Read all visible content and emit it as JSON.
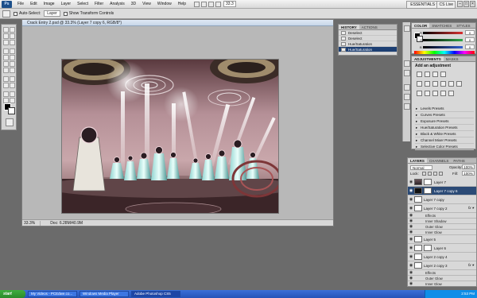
{
  "menubar": {
    "logo": "Ps",
    "items": [
      "File",
      "Edit",
      "Image",
      "Layer",
      "Select",
      "Filter",
      "Analysis",
      "3D",
      "View",
      "Window",
      "Help"
    ],
    "zoom": "33.3",
    "workspace": "ESSENTIALS ▾",
    "cs_label": "CS Live",
    "window_controls": [
      "–",
      "□",
      "×"
    ]
  },
  "options": {
    "auto_select_label": "Auto-Select:",
    "auto_select_value": "Layer",
    "transform_label": "Show Transform Controls"
  },
  "document": {
    "title": "Crack Entry 2.psd @ 33.3% (Layer 7 copy 6, RGB/8*)",
    "zoom": "33.3%",
    "doc_size": "Doc: 6.28M/40.9M"
  },
  "history": {
    "tabs": [
      "HISTORY",
      "ACTIONS"
    ],
    "items": [
      {
        "label": "Deselect"
      },
      {
        "label": "Deselect"
      },
      {
        "label": "Hue/Saturation"
      },
      {
        "label": "Hue/Saturation",
        "selected": true
      }
    ]
  },
  "color_panel": {
    "tabs": [
      "COLOR",
      "SWATCHES",
      "STYLES"
    ],
    "channels": [
      {
        "name": "R",
        "value": "0",
        "color": "#d93030"
      },
      {
        "name": "G",
        "value": "0",
        "color": "#2fa84a"
      },
      {
        "name": "B",
        "value": "0",
        "color": "#2f5fd0"
      }
    ]
  },
  "adjustments": {
    "tabs": [
      "ADJUSTMENTS",
      "MASKS"
    ],
    "heading": "Add an adjustment",
    "presets": [
      "Levels Presets",
      "Curves Presets",
      "Exposure Presets",
      "Hue/Saturation Presets",
      "Black & White Presets",
      "Channel Mixer Presets",
      "Selective Color Presets"
    ]
  },
  "layers": {
    "tabs": [
      "LAYERS",
      "CHANNELS",
      "PATHS"
    ],
    "blend_mode": "Normal",
    "opacity_label": "Opacity:",
    "opacity": "100%",
    "lock_label": "Lock:",
    "fill_label": "Fill:",
    "fill": "100%",
    "rows": [
      {
        "name": "Layer 7",
        "kind": "layer",
        "thumb": "dark",
        "mask": true
      },
      {
        "name": "Layer 7 copy 6",
        "kind": "layer",
        "thumb": "blk",
        "mask": true,
        "selected": true
      },
      {
        "name": "Layer 7 copy",
        "kind": "layer",
        "thumb": "white",
        "mask": false
      },
      {
        "name": "Layer 7 copy 2",
        "kind": "layer",
        "thumb": "white",
        "mask": false,
        "fx": true
      },
      {
        "name": "Effects",
        "kind": "sub"
      },
      {
        "name": "Inner Shadow",
        "kind": "sub"
      },
      {
        "name": "Outer Glow",
        "kind": "sub"
      },
      {
        "name": "Inner Glow",
        "kind": "sub"
      },
      {
        "name": "Layer 5",
        "kind": "layer",
        "thumb": "white",
        "mask": false
      },
      {
        "name": "Layer 6",
        "kind": "layer",
        "thumb": "white",
        "mask": true
      },
      {
        "name": "Layer 2 copy 4",
        "kind": "layer",
        "thumb": "white",
        "mask": false
      },
      {
        "name": "Layer 2 copy 3",
        "kind": "layer",
        "thumb": "white",
        "mask": false,
        "fx": true
      },
      {
        "name": "Effects",
        "kind": "sub"
      },
      {
        "name": "Outer Glow",
        "kind": "sub"
      },
      {
        "name": "Inner Glow",
        "kind": "sub"
      }
    ]
  },
  "taskbar": {
    "start": "start",
    "buttons": [
      {
        "label": "My Videos - PCEdwe.co..."
      },
      {
        "label": "Windows Media Player"
      },
      {
        "label": "Adobe Photoshop CS5",
        "active": true
      }
    ],
    "clock": "2:53 PM"
  },
  "colors": {
    "selection": "#1d3f73",
    "canvas_bg": "#b8b8b8",
    "workspace": "#6b6b6b"
  }
}
